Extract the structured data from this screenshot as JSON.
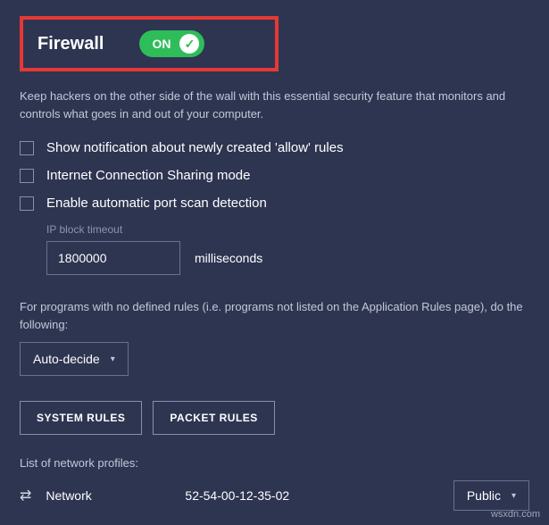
{
  "header": {
    "title": "Firewall",
    "toggle_state": "ON"
  },
  "description": "Keep hackers on the other side of the wall with this essential security feature that monitors and controls what goes in and out of your computer.",
  "checkboxes": {
    "show_notification": "Show notification about newly created 'allow' rules",
    "ics_mode": "Internet Connection Sharing mode",
    "port_scan": "Enable automatic port scan detection"
  },
  "ip_block": {
    "label": "IP block timeout",
    "value": "1800000",
    "unit": "milliseconds"
  },
  "rules_text": "For programs with no defined rules (i.e. programs not listed on the Application Rules page), do the following:",
  "rules_action_selected": "Auto-decide",
  "buttons": {
    "system_rules": "SYSTEM RULES",
    "packet_rules": "PACKET RULES"
  },
  "profiles": {
    "label": "List of network profiles:",
    "rows": [
      {
        "name": "Network",
        "mac": "52-54-00-12-35-02",
        "type": "Public"
      }
    ]
  },
  "watermark": "wsxdn.com"
}
